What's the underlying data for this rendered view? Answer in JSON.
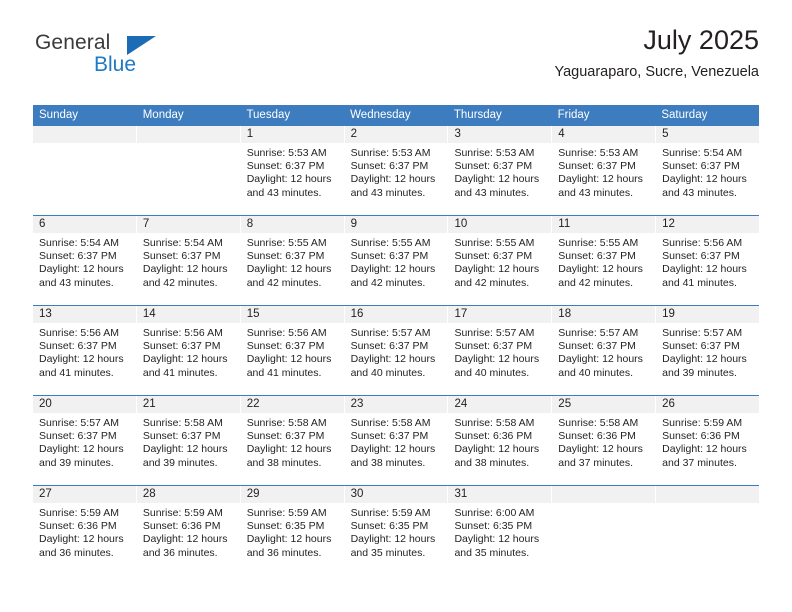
{
  "brand": {
    "name_top": "General",
    "name_bottom": "Blue",
    "accent_color": "#2079c4",
    "triangle_color": "#1b6cb5"
  },
  "header": {
    "title": "July 2025",
    "subtitle": "Yaguaraparo, Sucre, Venezuela"
  },
  "theme": {
    "header_row_bg": "#3c7cbf",
    "day_number_bg": "#f1f1f1",
    "text_color": "#231f20",
    "page_bg": "#ffffff"
  },
  "weekdays": [
    "Sunday",
    "Monday",
    "Tuesday",
    "Wednesday",
    "Thursday",
    "Friday",
    "Saturday"
  ],
  "weeks": [
    [
      {
        "day": "",
        "sunrise": "",
        "sunset": "",
        "daylight_line1": "",
        "daylight_line2": ""
      },
      {
        "day": "",
        "sunrise": "",
        "sunset": "",
        "daylight_line1": "",
        "daylight_line2": ""
      },
      {
        "day": "1",
        "sunrise": "Sunrise: 5:53 AM",
        "sunset": "Sunset: 6:37 PM",
        "daylight_line1": "Daylight: 12 hours",
        "daylight_line2": "and 43 minutes."
      },
      {
        "day": "2",
        "sunrise": "Sunrise: 5:53 AM",
        "sunset": "Sunset: 6:37 PM",
        "daylight_line1": "Daylight: 12 hours",
        "daylight_line2": "and 43 minutes."
      },
      {
        "day": "3",
        "sunrise": "Sunrise: 5:53 AM",
        "sunset": "Sunset: 6:37 PM",
        "daylight_line1": "Daylight: 12 hours",
        "daylight_line2": "and 43 minutes."
      },
      {
        "day": "4",
        "sunrise": "Sunrise: 5:53 AM",
        "sunset": "Sunset: 6:37 PM",
        "daylight_line1": "Daylight: 12 hours",
        "daylight_line2": "and 43 minutes."
      },
      {
        "day": "5",
        "sunrise": "Sunrise: 5:54 AM",
        "sunset": "Sunset: 6:37 PM",
        "daylight_line1": "Daylight: 12 hours",
        "daylight_line2": "and 43 minutes."
      }
    ],
    [
      {
        "day": "6",
        "sunrise": "Sunrise: 5:54 AM",
        "sunset": "Sunset: 6:37 PM",
        "daylight_line1": "Daylight: 12 hours",
        "daylight_line2": "and 43 minutes."
      },
      {
        "day": "7",
        "sunrise": "Sunrise: 5:54 AM",
        "sunset": "Sunset: 6:37 PM",
        "daylight_line1": "Daylight: 12 hours",
        "daylight_line2": "and 42 minutes."
      },
      {
        "day": "8",
        "sunrise": "Sunrise: 5:55 AM",
        "sunset": "Sunset: 6:37 PM",
        "daylight_line1": "Daylight: 12 hours",
        "daylight_line2": "and 42 minutes."
      },
      {
        "day": "9",
        "sunrise": "Sunrise: 5:55 AM",
        "sunset": "Sunset: 6:37 PM",
        "daylight_line1": "Daylight: 12 hours",
        "daylight_line2": "and 42 minutes."
      },
      {
        "day": "10",
        "sunrise": "Sunrise: 5:55 AM",
        "sunset": "Sunset: 6:37 PM",
        "daylight_line1": "Daylight: 12 hours",
        "daylight_line2": "and 42 minutes."
      },
      {
        "day": "11",
        "sunrise": "Sunrise: 5:55 AM",
        "sunset": "Sunset: 6:37 PM",
        "daylight_line1": "Daylight: 12 hours",
        "daylight_line2": "and 42 minutes."
      },
      {
        "day": "12",
        "sunrise": "Sunrise: 5:56 AM",
        "sunset": "Sunset: 6:37 PM",
        "daylight_line1": "Daylight: 12 hours",
        "daylight_line2": "and 41 minutes."
      }
    ],
    [
      {
        "day": "13",
        "sunrise": "Sunrise: 5:56 AM",
        "sunset": "Sunset: 6:37 PM",
        "daylight_line1": "Daylight: 12 hours",
        "daylight_line2": "and 41 minutes."
      },
      {
        "day": "14",
        "sunrise": "Sunrise: 5:56 AM",
        "sunset": "Sunset: 6:37 PM",
        "daylight_line1": "Daylight: 12 hours",
        "daylight_line2": "and 41 minutes."
      },
      {
        "day": "15",
        "sunrise": "Sunrise: 5:56 AM",
        "sunset": "Sunset: 6:37 PM",
        "daylight_line1": "Daylight: 12 hours",
        "daylight_line2": "and 41 minutes."
      },
      {
        "day": "16",
        "sunrise": "Sunrise: 5:57 AM",
        "sunset": "Sunset: 6:37 PM",
        "daylight_line1": "Daylight: 12 hours",
        "daylight_line2": "and 40 minutes."
      },
      {
        "day": "17",
        "sunrise": "Sunrise: 5:57 AM",
        "sunset": "Sunset: 6:37 PM",
        "daylight_line1": "Daylight: 12 hours",
        "daylight_line2": "and 40 minutes."
      },
      {
        "day": "18",
        "sunrise": "Sunrise: 5:57 AM",
        "sunset": "Sunset: 6:37 PM",
        "daylight_line1": "Daylight: 12 hours",
        "daylight_line2": "and 40 minutes."
      },
      {
        "day": "19",
        "sunrise": "Sunrise: 5:57 AM",
        "sunset": "Sunset: 6:37 PM",
        "daylight_line1": "Daylight: 12 hours",
        "daylight_line2": "and 39 minutes."
      }
    ],
    [
      {
        "day": "20",
        "sunrise": "Sunrise: 5:57 AM",
        "sunset": "Sunset: 6:37 PM",
        "daylight_line1": "Daylight: 12 hours",
        "daylight_line2": "and 39 minutes."
      },
      {
        "day": "21",
        "sunrise": "Sunrise: 5:58 AM",
        "sunset": "Sunset: 6:37 PM",
        "daylight_line1": "Daylight: 12 hours",
        "daylight_line2": "and 39 minutes."
      },
      {
        "day": "22",
        "sunrise": "Sunrise: 5:58 AM",
        "sunset": "Sunset: 6:37 PM",
        "daylight_line1": "Daylight: 12 hours",
        "daylight_line2": "and 38 minutes."
      },
      {
        "day": "23",
        "sunrise": "Sunrise: 5:58 AM",
        "sunset": "Sunset: 6:37 PM",
        "daylight_line1": "Daylight: 12 hours",
        "daylight_line2": "and 38 minutes."
      },
      {
        "day": "24",
        "sunrise": "Sunrise: 5:58 AM",
        "sunset": "Sunset: 6:36 PM",
        "daylight_line1": "Daylight: 12 hours",
        "daylight_line2": "and 38 minutes."
      },
      {
        "day": "25",
        "sunrise": "Sunrise: 5:58 AM",
        "sunset": "Sunset: 6:36 PM",
        "daylight_line1": "Daylight: 12 hours",
        "daylight_line2": "and 37 minutes."
      },
      {
        "day": "26",
        "sunrise": "Sunrise: 5:59 AM",
        "sunset": "Sunset: 6:36 PM",
        "daylight_line1": "Daylight: 12 hours",
        "daylight_line2": "and 37 minutes."
      }
    ],
    [
      {
        "day": "27",
        "sunrise": "Sunrise: 5:59 AM",
        "sunset": "Sunset: 6:36 PM",
        "daylight_line1": "Daylight: 12 hours",
        "daylight_line2": "and 36 minutes."
      },
      {
        "day": "28",
        "sunrise": "Sunrise: 5:59 AM",
        "sunset": "Sunset: 6:36 PM",
        "daylight_line1": "Daylight: 12 hours",
        "daylight_line2": "and 36 minutes."
      },
      {
        "day": "29",
        "sunrise": "Sunrise: 5:59 AM",
        "sunset": "Sunset: 6:35 PM",
        "daylight_line1": "Daylight: 12 hours",
        "daylight_line2": "and 36 minutes."
      },
      {
        "day": "30",
        "sunrise": "Sunrise: 5:59 AM",
        "sunset": "Sunset: 6:35 PM",
        "daylight_line1": "Daylight: 12 hours",
        "daylight_line2": "and 35 minutes."
      },
      {
        "day": "31",
        "sunrise": "Sunrise: 6:00 AM",
        "sunset": "Sunset: 6:35 PM",
        "daylight_line1": "Daylight: 12 hours",
        "daylight_line2": "and 35 minutes."
      },
      {
        "day": "",
        "sunrise": "",
        "sunset": "",
        "daylight_line1": "",
        "daylight_line2": ""
      },
      {
        "day": "",
        "sunrise": "",
        "sunset": "",
        "daylight_line1": "",
        "daylight_line2": ""
      }
    ]
  ]
}
